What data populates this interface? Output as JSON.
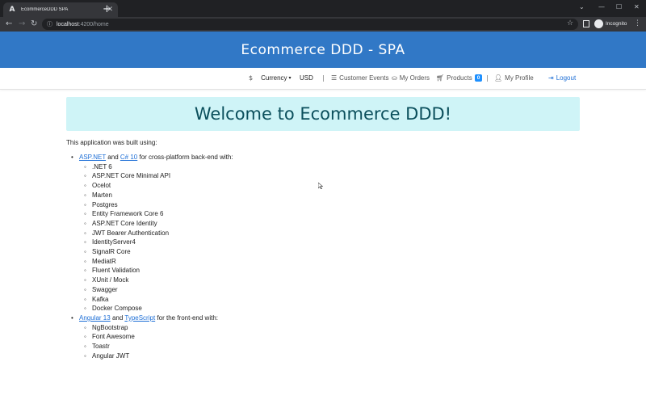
{
  "browser": {
    "tab_title": "EcommerceDDD SPA",
    "tab_favicon": "A",
    "url_host": "localhost",
    "url_path": ":4200/home",
    "profile_label": "Incognito"
  },
  "header": {
    "title": "Ecommerce DDD - SPA"
  },
  "navbar": {
    "currency_label": "Currency",
    "currency_value": "USD",
    "customer_events": "Customer Events",
    "my_orders": "My Orders",
    "products": "Products",
    "products_count": "0",
    "my_profile": "My Profile",
    "logout": "Logout"
  },
  "jumbotron": {
    "title": "Welcome to Ecommerce DDD!"
  },
  "content": {
    "intro": "This application was built using:",
    "backend": {
      "link1": "ASP.NET",
      "and": "and",
      "link2": "C# 10",
      "suffix": "for cross-platform back-end with:",
      "items": [
        ".NET 6",
        "ASP.NET Core Minimal API",
        "Ocelot",
        "Marten",
        "Postgres",
        "Entity Framework Core 6",
        "ASP.NET Core Identity",
        "JWT Bearer Authentication",
        "IdentityServer4",
        "SignalR Core",
        "MediatR",
        "Fluent Validation",
        "XUnit / Mock",
        "Swagger",
        "Kafka",
        "Docker Compose"
      ]
    },
    "frontend": {
      "link1": "Angular 13",
      "and": "and",
      "link2": "TypeScript",
      "suffix": "for the front-end with:",
      "items": [
        "NgBootstrap",
        "Font Awesome",
        "Toastr",
        "Angular JWT"
      ]
    }
  },
  "colors": {
    "header_bg": "#3178c6",
    "jumbotron_bg": "#cff4f7",
    "jumbotron_text": "#0b4f5c",
    "link": "#1e6fd6",
    "badge": "#1e90ff"
  },
  "icons": {
    "currency": "dollar-icon",
    "customer_events": "list-icon",
    "my_orders": "basket-icon",
    "products": "cart-icon",
    "my_profile": "user-icon",
    "logout": "sign-out-icon"
  }
}
